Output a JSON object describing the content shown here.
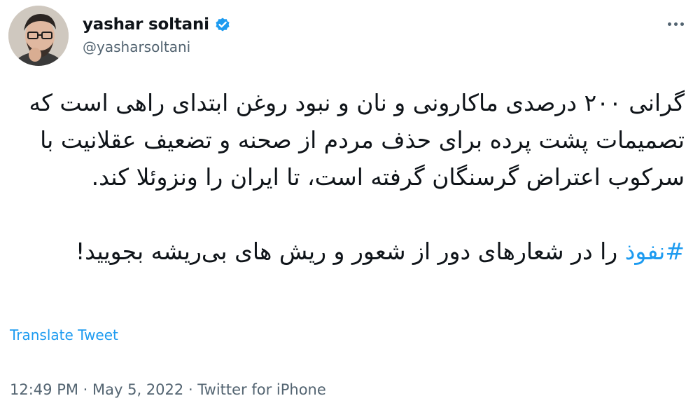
{
  "user": {
    "display_name": "yashar soltani",
    "handle": "@yasharsoltani",
    "verified": true
  },
  "tweet": {
    "paragraph1": "گرانی ۲۰۰ درصدی ماکارونی و نان و نبود روغن ابتدای راهی است که تصمیمات پشت پرده برای حذف مردم از صحنه و تضعیف عقلانیت با سرکوب اعتراض گرسنگان گرفته است، تا ایران را ونزوئلا کند.",
    "hashtag": "#نفوذ",
    "paragraph2_rest": " را در شعارهای دور از شعور و ریش های بی‌ریشه بجویید!"
  },
  "translate_label": "Translate Tweet",
  "meta": {
    "time": "12:49 PM",
    "separator": " · ",
    "date": "May 5, 2022",
    "source": "Twitter for iPhone"
  },
  "colors": {
    "accent": "#1d9bf0",
    "text": "#0f1419",
    "muted": "#536471"
  },
  "icons": {
    "verified": "verified-badge-icon",
    "more": "more-dots-icon"
  }
}
